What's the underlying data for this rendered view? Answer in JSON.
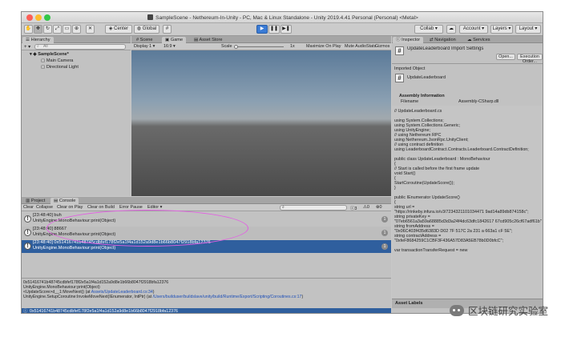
{
  "window": {
    "title": "SampleScene - Nethereum-In-Unity - PC, Mac & Linux Standalone - Unity 2019.4.41 Personal (Personal) <Metal>"
  },
  "toolbar": {
    "pivot_center": "Center",
    "pivot_global": "Global",
    "collab": "Collab",
    "account": "Account",
    "layers": "Layers",
    "layout": "Layout"
  },
  "hierarchy": {
    "tab": "Hierarchy",
    "create": "+",
    "search_placeholder": "All",
    "scene": "SampleScene*",
    "items": [
      "Main Camera",
      "Directional Light"
    ]
  },
  "center": {
    "tabs": [
      "Scene",
      "Game",
      "Asset Store"
    ],
    "display": "Display 1",
    "aspect": "16:9",
    "scale_label": "Scale",
    "scale_value": "1x",
    "options": [
      "Maximize On Play",
      "Mute Audio",
      "Stats",
      "Gizmos"
    ]
  },
  "console": {
    "tabs": [
      "Project",
      "Console"
    ],
    "buttons": [
      "Clear",
      "Collapse",
      "Clear on Play",
      "Clear on Build",
      "Error Pause",
      "Editor"
    ],
    "counts": [
      "3",
      "0",
      "0"
    ],
    "entries": [
      {
        "line1": "[23:48:40] buh",
        "line2": "UnityEngine.MonoBehaviour:print(Object)",
        "count": "1"
      },
      {
        "line1": "[23:48:40] 88667",
        "line2": "UnityEngine.MonoBehaviour:print(Object)",
        "count": "1"
      },
      {
        "line1": "[23:48:40] 0x51416741b48745cdbfef178f2e5a1f4a1d152a9d8e1b66b8047f2918bfa12376",
        "line2": "UnityEngine.MonoBehaviour:print(Object)",
        "count": "1"
      }
    ],
    "detail": {
      "line1": "0x51416741b48745cdbfef178f2e5a1f4a1d152a9d8e1b66b8047f2918bfa12376",
      "line2": "UnityEngine.MonoBehaviour:print(Object)",
      "line3_pre": "<UpdateScore>d__1:MoveNext() (at ",
      "line3_link": "Assets/UpdateLeaderboard.cs:34",
      "line3_post": ")",
      "line4_pre": "UnityEngine.SetupCoroutine:InvokeMoveNext(IEnumerator, IntPtr) (at ",
      "line4_link": "/Users/builduser/buildslave/unity/build/Runtime/Export/Scripting/Coroutines.cs:17",
      "line4_post": ")"
    },
    "status": "0x51416741b48745cdbfef178f2e5a1f4a1d152a9d8e1b66b8047f2918bfa12376"
  },
  "inspector": {
    "tabs": [
      "Inspector",
      "Navigation",
      "Services"
    ],
    "title": "UpdateLeaderboard Import Settings",
    "open_button": "Open...",
    "exec_button": "Execution Order...",
    "imported_object": "Imported Object",
    "object_name": "UpdateLeaderboard",
    "assembly_header": "Assembly Information",
    "filename_label": "Filename",
    "filename_value": "Assembly-CSharp.dll",
    "code_lines": [
      "// UpdateLeaderboard.cs",
      "",
      "using System.Collections;",
      "using System.Collections.Generic;",
      "using UnityEngine;",
      "// using Nethereum RPC",
      "using Nethereum.JsonRpc.UnityClient;",
      "// using contract definition",
      "using LeaderboardContract.Contracts.Leaderboard.ContractDefinition;",
      "",
      "public class UpdateLeaderboard : MonoBehaviour",
      "{",
      "    // Start is called before the first frame update",
      "    void Start()",
      "    {",
      "        StartCoroutine(UpdateScore());",
      "    }",
      "",
      "    public IEnumerator UpdateScore()",
      "    {",
      "        string url =",
      "\"https://rinkeby.infura.io/v3/7234321101034471 9ad14a89db874158c\";",
      "        string privateKey =",
      "\"07eb6561a3a59a68885d3d3a24f4dc63dfc1842617 67cd905c26cf67adf61b\";",
      "        string fromAddress =",
      "\"0x06C403f435d6383D D02 7F 517C 2a 231 a 663a1 cF 5E\";",
      "        string contractAddress =",
      "\"0xfeF8684259C1CBF3F436A57D83A5EB78b0D0bfcC\";",
      "",
      "        var transactionTransferRequest = new"
    ],
    "asset_labels": "Asset Labels"
  },
  "watermark": {
    "text": "区块链研究实验室"
  },
  "colors": {
    "accent": "#2f5f9e",
    "highlight_ellipse": "#e35fe3",
    "play": "#3a7bd5"
  }
}
